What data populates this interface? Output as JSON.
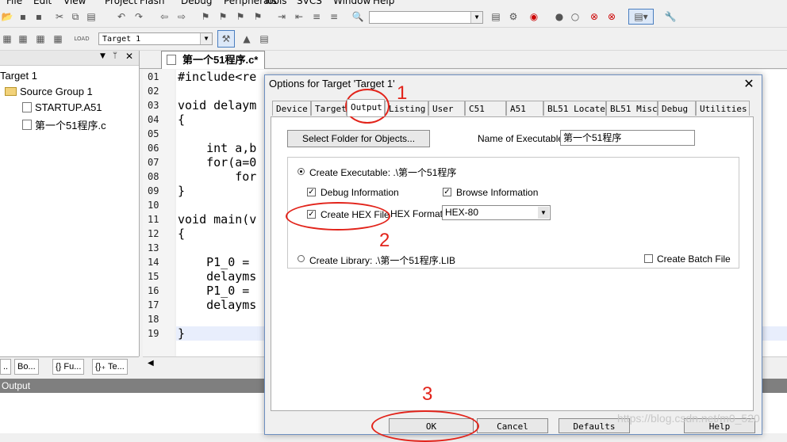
{
  "menu": [
    "File",
    "Edit",
    "View",
    "Project",
    "Flash",
    "Debug",
    "Peripherals",
    "Tools",
    "SVCS",
    "Window",
    "Help"
  ],
  "toolbar2": {
    "target_select": "Target 1"
  },
  "project": {
    "root": "Target 1",
    "group": "Source Group 1",
    "files": [
      "STARTUP.A51",
      "第一个51程序.c"
    ],
    "tabs": [
      "Bo...",
      "{} Fu...",
      "{}₊ Te..."
    ]
  },
  "editor": {
    "tab": "第一个51程序.c*",
    "line_numbers": [
      "01",
      "02",
      "03",
      "04",
      "05",
      "06",
      "07",
      "08",
      "09",
      "10",
      "11",
      "12",
      "13",
      "14",
      "15",
      "16",
      "17",
      "18",
      "19"
    ],
    "lines": [
      "#include<re",
      "",
      "void delaym",
      "{",
      "",
      "    int a,b",
      "    for(a=0",
      "        for",
      "}",
      "",
      "void main(v",
      "{",
      "",
      "    P1_0 =",
      "    delayms",
      "    P1_0 =",
      "    delayms",
      "",
      "}"
    ]
  },
  "output_panel": {
    "title": "Output"
  },
  "dialog": {
    "title": "Options for Target 'Target 1'",
    "tabs": [
      "Device",
      "Target",
      "Output",
      "Listing",
      "User",
      "C51",
      "A51",
      "BL51 Locate",
      "BL51 Misc",
      "Debug",
      "Utilities"
    ],
    "active_tab": "Output",
    "select_folder_btn": "Select Folder for Objects...",
    "name_exec_label": "Name of Executable:",
    "name_exec_value": "第一个51程序",
    "create_exec_label": "Create Executable:  .\\第一个51程序",
    "debug_info": "Debug Information",
    "browse_info": "Browse Information",
    "create_hex": "Create HEX File",
    "hex_format_label": "HEX Format:",
    "hex_format_value": "HEX-80",
    "create_lib": "Create Library:  .\\第一个51程序.LIB",
    "create_batch": "Create Batch File",
    "buttons": {
      "ok": "OK",
      "cancel": "Cancel",
      "defaults": "Defaults",
      "help": "Help"
    }
  },
  "annotations": {
    "step1": "1",
    "step2": "2",
    "step3": "3"
  },
  "watermark": "https://blog.csdn.net/m0_520",
  "colors": {
    "annotation": "#e2231a",
    "output_header": "#7f7f7f",
    "dialog_border": "#6d8fc0"
  }
}
